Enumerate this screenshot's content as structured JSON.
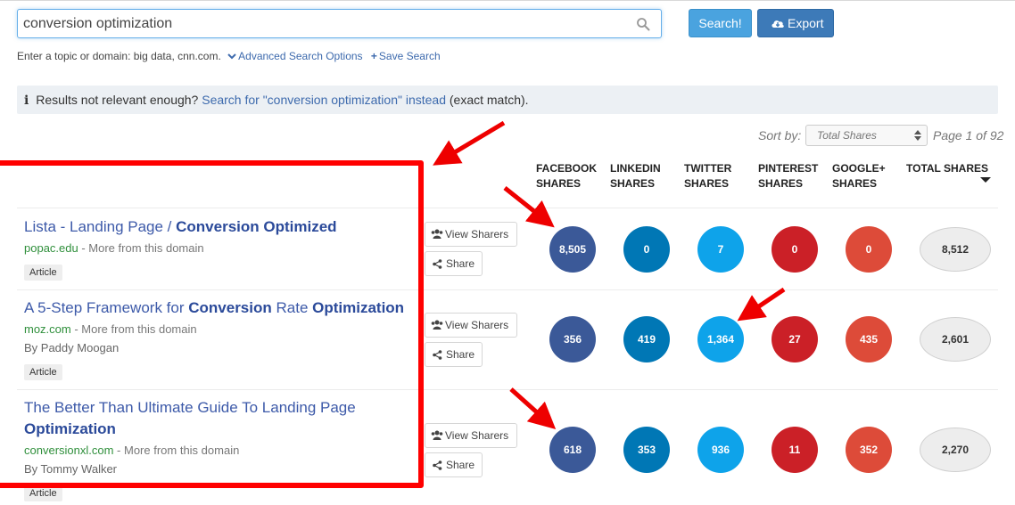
{
  "search": {
    "value": "conversion optimization",
    "search_button": "Search!",
    "export_button": "Export"
  },
  "hint": {
    "text": "Enter a topic or domain: big data, cnn.com.",
    "advanced": "Advanced Search Options",
    "save": "Save Search"
  },
  "notice": {
    "prefix": "Results not relevant enough?",
    "link": "Search for \"conversion optimization\" instead",
    "suffix": "(exact match)."
  },
  "sort": {
    "label": "Sort by:",
    "selected": "Total Shares",
    "page": "Page 1 of 92"
  },
  "columns": {
    "facebook": [
      "FACEBOOK",
      "SHARES"
    ],
    "linkedin": [
      "LINKEDIN",
      "SHARES"
    ],
    "twitter": [
      "TWITTER",
      "SHARES"
    ],
    "pinterest": [
      "PINTEREST",
      "SHARES"
    ],
    "googleplus": [
      "GOOGLE+",
      "SHARES"
    ],
    "total": "TOTAL SHARES"
  },
  "buttons": {
    "view_sharers": "View Sharers",
    "share": "Share"
  },
  "results": [
    {
      "title_parts": [
        "Lista - Landing Page / ",
        "Conversion Optimized"
      ],
      "domain": "popac.edu",
      "more": " - More from this domain",
      "author": "",
      "badge": "Article",
      "facebook": "8,505",
      "linkedin": "0",
      "twitter": "7",
      "pinterest": "0",
      "googleplus": "0",
      "total": "8,512"
    },
    {
      "title_parts": [
        "A 5-Step Framework for ",
        "Conversion",
        " Rate ",
        "Optimization"
      ],
      "domain": "moz.com",
      "more": " - More from this domain",
      "author": "By Paddy Moogan",
      "badge": "Article",
      "facebook": "356",
      "linkedin": "419",
      "twitter": "1,364",
      "pinterest": "27",
      "googleplus": "435",
      "total": "2,601"
    },
    {
      "title_parts": [
        "The Better Than Ultimate Guide To Landing Page",
        "Optimization"
      ],
      "domain": "conversionxl.com",
      "more": " - More from this domain",
      "author": "By Tommy Walker",
      "badge": "Article",
      "facebook": "618",
      "linkedin": "353",
      "twitter": "936",
      "pinterest": "11",
      "googleplus": "352",
      "total": "2,270"
    }
  ],
  "colors": {
    "facebook": "#3b5998",
    "linkedin": "#0077b5",
    "twitter": "#0ea3ea",
    "pinterest": "#cb2027",
    "googleplus": "#dd4b39",
    "annotation": "#ff0000",
    "link": "#3d5aa9"
  }
}
